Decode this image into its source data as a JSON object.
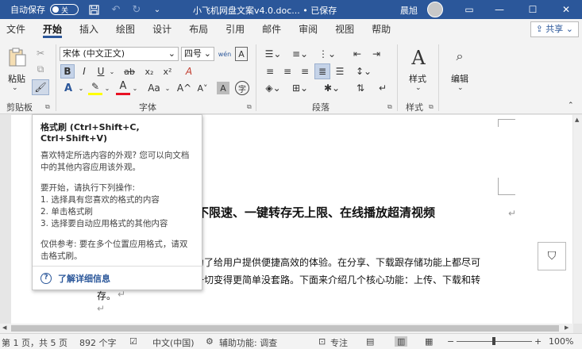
{
  "titlebar": {
    "autosave_label": "自动保存",
    "autosave_state": "关",
    "doc_title": "小飞机网盘文案v4.0.doc... • 已保存",
    "user_name": "晨旭",
    "icons": [
      "save-icon",
      "undo-icon",
      "redo-icon",
      "quick-access-dropdown-icon"
    ],
    "window_controls": [
      "ribbon-display-icon",
      "minimize-icon",
      "maximize-icon",
      "close-icon"
    ]
  },
  "tabs": [
    {
      "label": "文件",
      "active": false
    },
    {
      "label": "开始",
      "active": true
    },
    {
      "label": "插入",
      "active": false
    },
    {
      "label": "绘图",
      "active": false
    },
    {
      "label": "设计",
      "active": false
    },
    {
      "label": "布局",
      "active": false
    },
    {
      "label": "引用",
      "active": false
    },
    {
      "label": "邮件",
      "active": false
    },
    {
      "label": "审阅",
      "active": false
    },
    {
      "label": "视图",
      "active": false
    },
    {
      "label": "帮助",
      "active": false
    }
  ],
  "share_label": "共享",
  "ribbon": {
    "clipboard": {
      "paste_label": "粘贴",
      "group_label": "剪贴板"
    },
    "font": {
      "font_name": "宋体 (中文正文)",
      "font_size": "四号",
      "group_label": "字体",
      "bold": "B",
      "italic": "I",
      "underline": "U",
      "strike": "ab",
      "subscript": "x₂",
      "superscript": "x²",
      "case": "Aa",
      "grow": "A^",
      "shrink": "A˅"
    },
    "paragraph": {
      "group_label": "段落"
    },
    "styles": {
      "label": "样式",
      "group_label": "样式"
    },
    "editing": {
      "label": "编辑"
    }
  },
  "tooltip": {
    "title": "格式刷 (Ctrl+Shift+C, Ctrl+Shift+V)",
    "desc1": "喜欢特定所选内容的外观? 您可以向文档中的其他内容应用该外观。",
    "steps_title": "要开始，请执行下列操作:",
    "step1": "1. 选择具有您喜欢的格式的内容",
    "step2": "2. 单击格式刷",
    "step3": "3. 选择要自动应用格式的其他内容",
    "tip": "仅供参考: 要在多个位置应用格式，请双击格式刷。",
    "link": "了解详细信息"
  },
  "document": {
    "heading": "不限速、一键转存无上限、在线播放超清视频",
    "line1": "为了给用户提供便捷高效的体验。在分享、下载跟存储功能上都尽可",
    "line2": "一切变得更简单没套路。下面来介绍几个核心功能：上传、下载和转",
    "line3": "存。"
  },
  "status": {
    "page": "第 1 页，共 5 页",
    "words": "892 个字",
    "language": "中文(中国)",
    "accessibility": "辅助功能: 调查",
    "focus": "专注",
    "zoom": "100%"
  },
  "colors": {
    "titlebar": "#2b579a",
    "ribbon_bg": "#f3f3f3",
    "accent": "#2b579a"
  }
}
